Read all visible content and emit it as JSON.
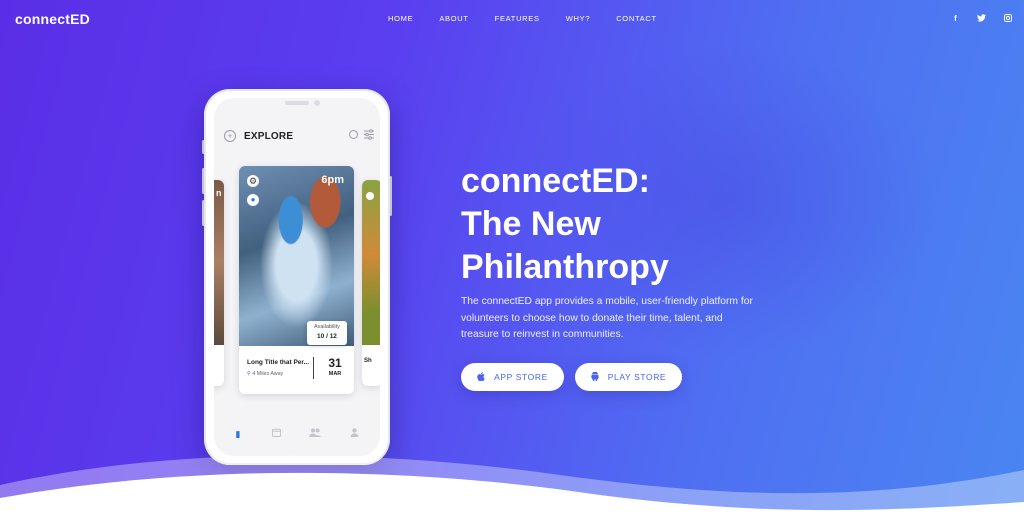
{
  "nav": {
    "logo_prefix": "connect",
    "logo_suffix": "ED",
    "links": [
      "HOME",
      "ABOUT",
      "FEATURES",
      "WHY?",
      "CONTACT"
    ],
    "social": [
      {
        "icon": "facebook-icon",
        "glyph": "f"
      },
      {
        "icon": "twitter-icon",
        "glyph": "✦"
      },
      {
        "icon": "instagram-icon",
        "glyph": "◙"
      }
    ]
  },
  "hero": {
    "title_lines": [
      "connectED:",
      "The New",
      "Philanthropy"
    ],
    "description": "The connectED app provides a mobile, user-friendly platform for volunteers to choose how to donate their time, talent, and treasure to reinvest in communities.",
    "buttons": {
      "app_store": "APP STORE",
      "play_store": "PLAY STORE"
    }
  },
  "phone": {
    "screen_title": "EXPLORE",
    "card": {
      "time": "6pm",
      "availability_label": "Availability",
      "availability_value": "10 / 12",
      "title": "Long Title that Per...",
      "distance": "4 Miles Away",
      "day": "31",
      "month": "MAR"
    },
    "left_peek_text": "n",
    "right_peek_text": "Sh"
  },
  "colors": {
    "gradient_start": "#5a2ee6",
    "gradient_end": "#4a86f2",
    "accent_blue": "#2a79e8",
    "button_text": "#4a63f0"
  }
}
